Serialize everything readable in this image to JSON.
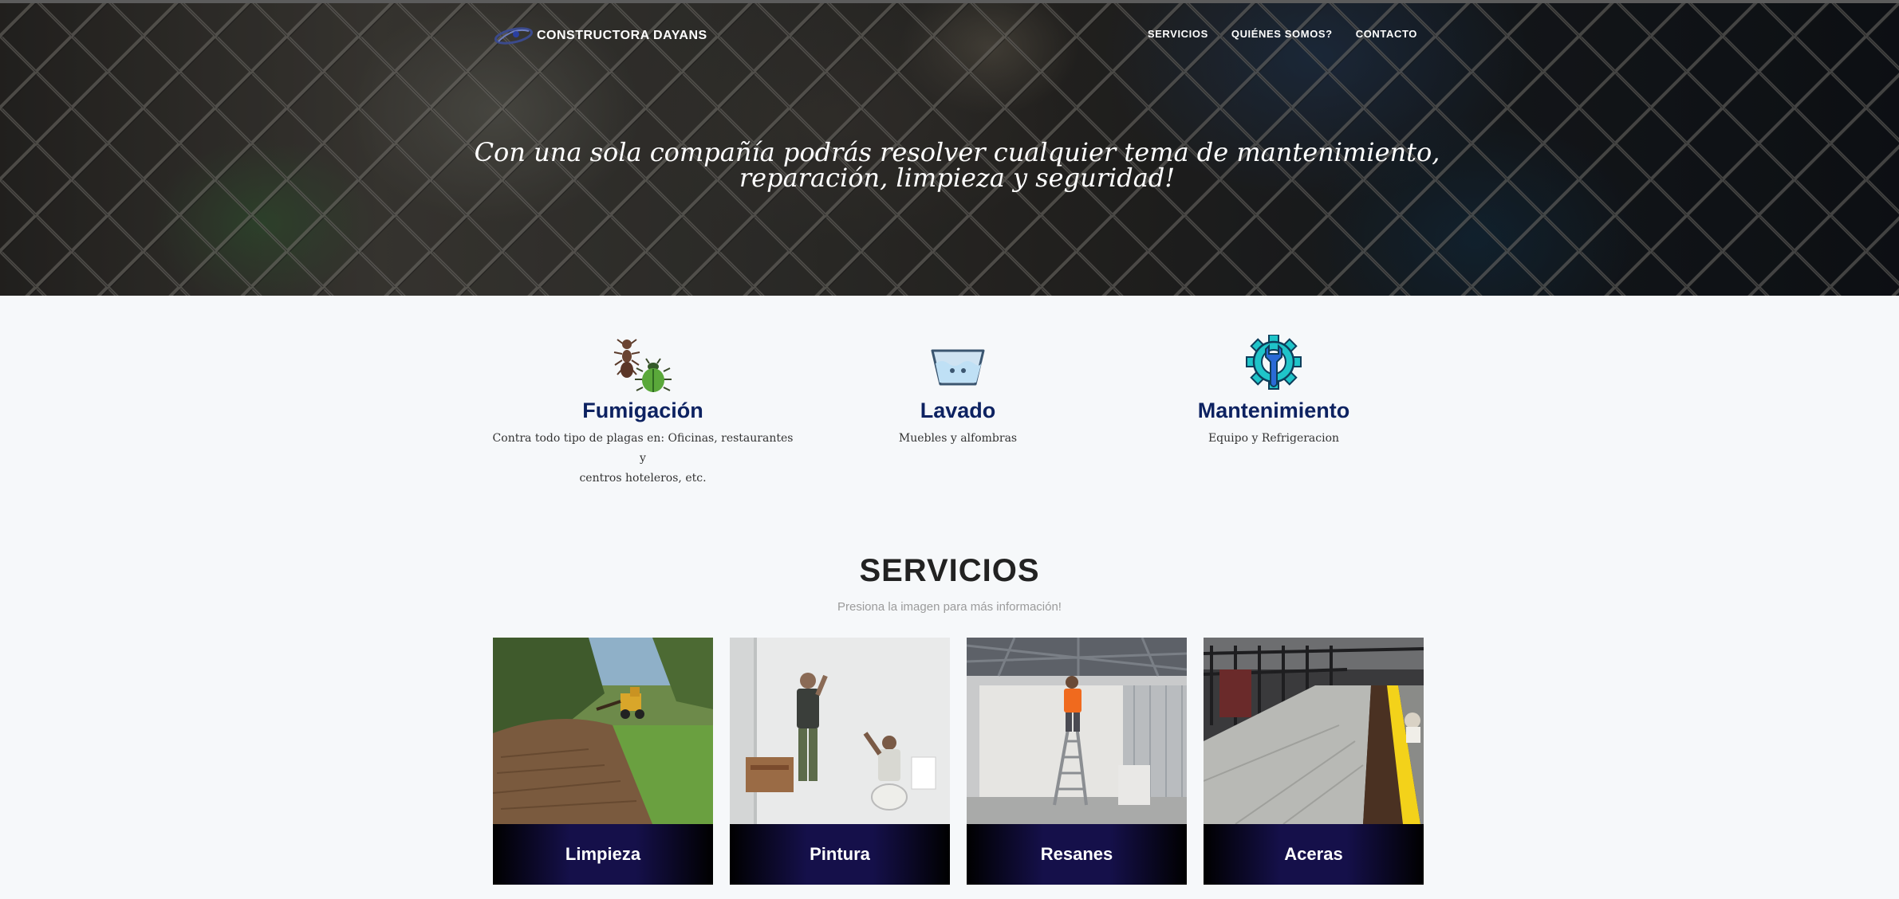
{
  "header": {
    "brand_name": "CONSTRUCTORA DAYANS",
    "logo_icon": "swoosh-logo-icon",
    "nav": [
      {
        "label": "SERVICIOS"
      },
      {
        "label": "QUIÉNES SOMOS?"
      },
      {
        "label": "CONTACTO"
      }
    ]
  },
  "hero": {
    "line1": "Con una sola compañía podrás resolver cualquier tema de mantenimiento,",
    "line2": "reparación, limpieza y seguridad!"
  },
  "features": [
    {
      "icon": "bugs-icon",
      "title": "Fumigación",
      "line1": "Contra todo tipo de plagas en: Oficinas, restaurantes y",
      "line2": "centros hoteleros, etc."
    },
    {
      "icon": "washing-basin-icon",
      "title": "Lavado",
      "line1": "Muebles y alfombras",
      "line2": ""
    },
    {
      "icon": "gear-wrench-icon",
      "title": "Mantenimiento",
      "line1": "Equipo y Refrigeracion",
      "line2": ""
    }
  ],
  "services": {
    "title": "SERVICIOS",
    "subtitle": "Presiona la imagen para más información!",
    "cards": [
      {
        "label": "Limpieza"
      },
      {
        "label": "Pintura"
      },
      {
        "label": "Resanes"
      },
      {
        "label": "Aceras"
      }
    ]
  },
  "colors": {
    "accent_navy": "#0d2261",
    "card_label_bg": "#15104a",
    "page_bg": "#f6f8fa"
  }
}
